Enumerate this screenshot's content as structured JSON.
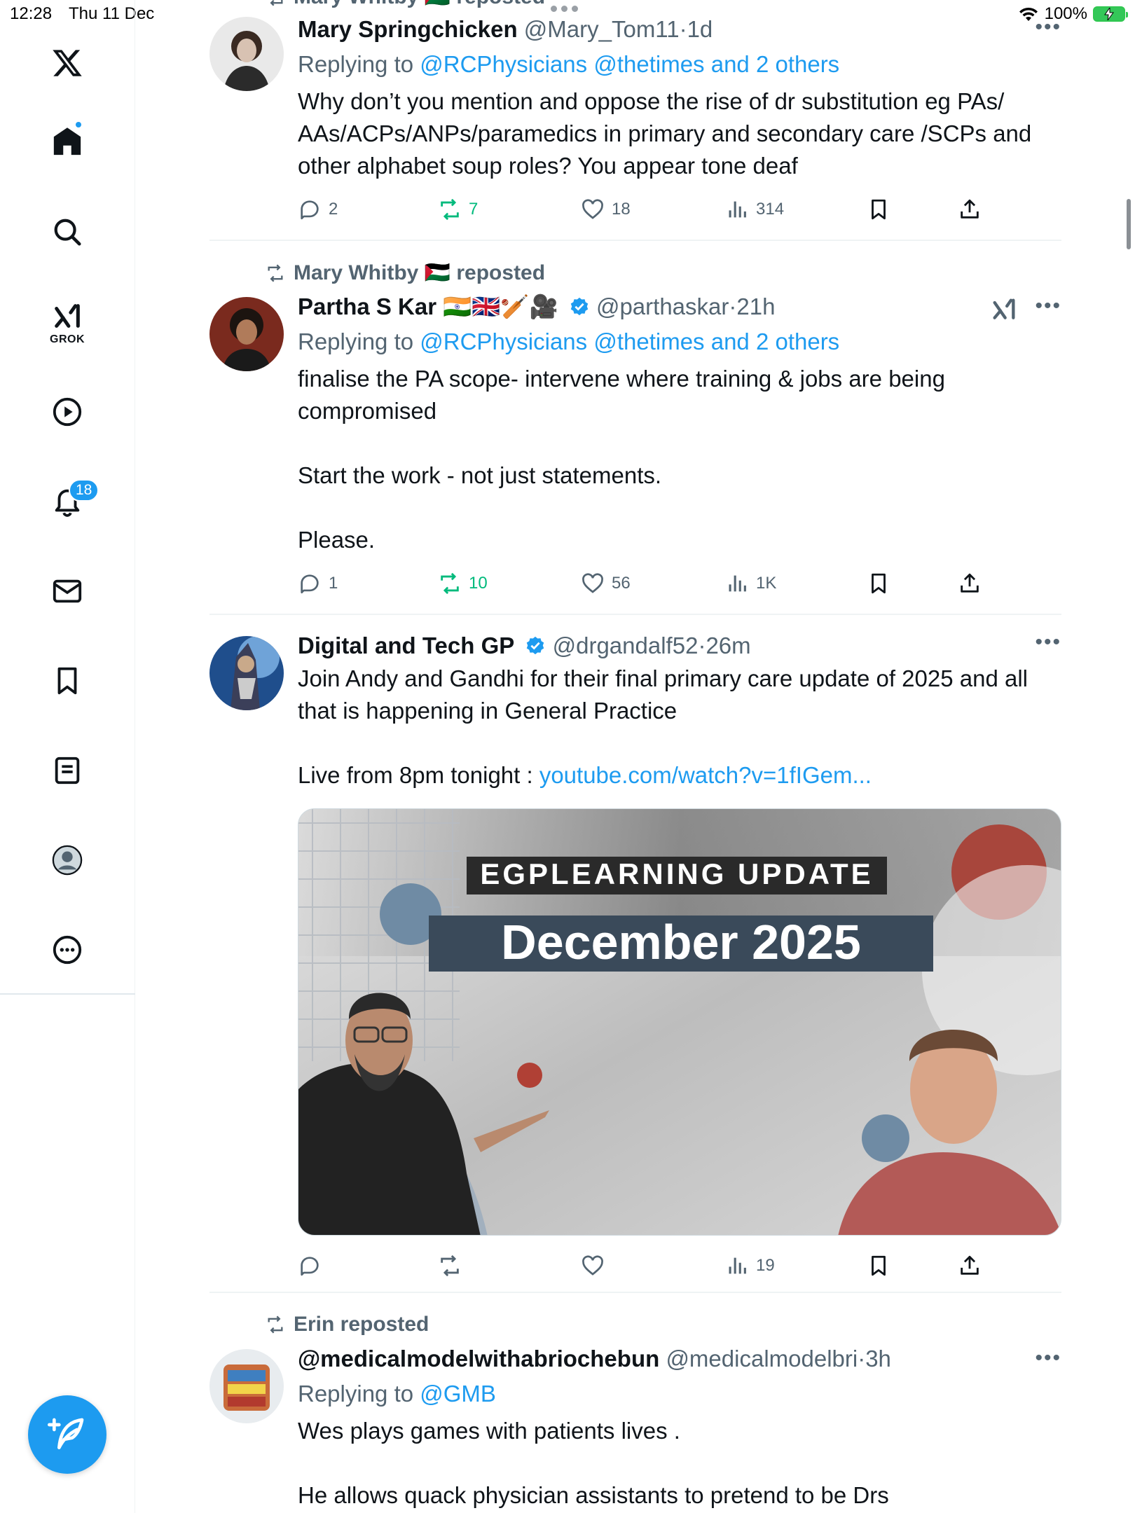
{
  "status_bar": {
    "time": "12:28",
    "date": "Thu 11 Dec",
    "battery": "100%"
  },
  "sidebar": {
    "grok_label": "GROK",
    "notifications_badge": "18"
  },
  "tweets": [
    {
      "repost_by": "Mary Whitby 🇵🇸 reposted",
      "name": "Mary Springchicken",
      "handle": "@Mary_Tom11",
      "time": "1d",
      "replying_prefix": "Replying to ",
      "replying_to": "@RCPhysicians @thetimes and 2 others",
      "text": "Why don’t you mention and oppose the rise of dr substitution eg PAs/ AAs/ACPs/ANPs/paramedics in primary and secondary care /SCPs and other alphabet soup roles?  You appear tone deaf",
      "replies": "2",
      "reposts": "7",
      "likes": "18",
      "views": "314"
    },
    {
      "repost_by": "Mary Whitby 🇵🇸 reposted",
      "name": "Partha S Kar 🇮🇳🇬🇧🏏🎥",
      "handle": "@parthaskar",
      "time": "21h",
      "replying_prefix": "Replying to ",
      "replying_to": "@RCPhysicians @thetimes and 2 others",
      "text": "finalise the PA scope- intervene where training & jobs are being compromised\n\nStart the work - not just statements.\n\nPlease.",
      "replies": "1",
      "reposts": "10",
      "likes": "56",
      "views": "1K"
    },
    {
      "name": "Digital and Tech GP",
      "handle": "@drgandalf52",
      "time": "26m",
      "text": "Join Andy and Gandhi for their final primary care update of 2025 and all that is happening in General Practice\n\nLive from 8pm tonight : ",
      "link": "youtube.com/watch?v=1fIGem...",
      "media_banner": "EGPLEARNING UPDATE",
      "media_title": "December 2025",
      "replies": "",
      "reposts": "",
      "likes": "",
      "views": "19"
    },
    {
      "repost_by": "Erin reposted",
      "name": "@medicalmodelwithabriochebun",
      "handle": "@medicalmodelbri",
      "time": "3h",
      "replying_prefix": "Replying to ",
      "replying_to": "@GMB",
      "text": "Wes plays games with patients lives .\n\nHe allows quack physician assistants to pretend to be Drs"
    }
  ],
  "colors": {
    "accent": "#1d9bf0",
    "muted": "#536471",
    "repost_green": "#00ba7c"
  }
}
